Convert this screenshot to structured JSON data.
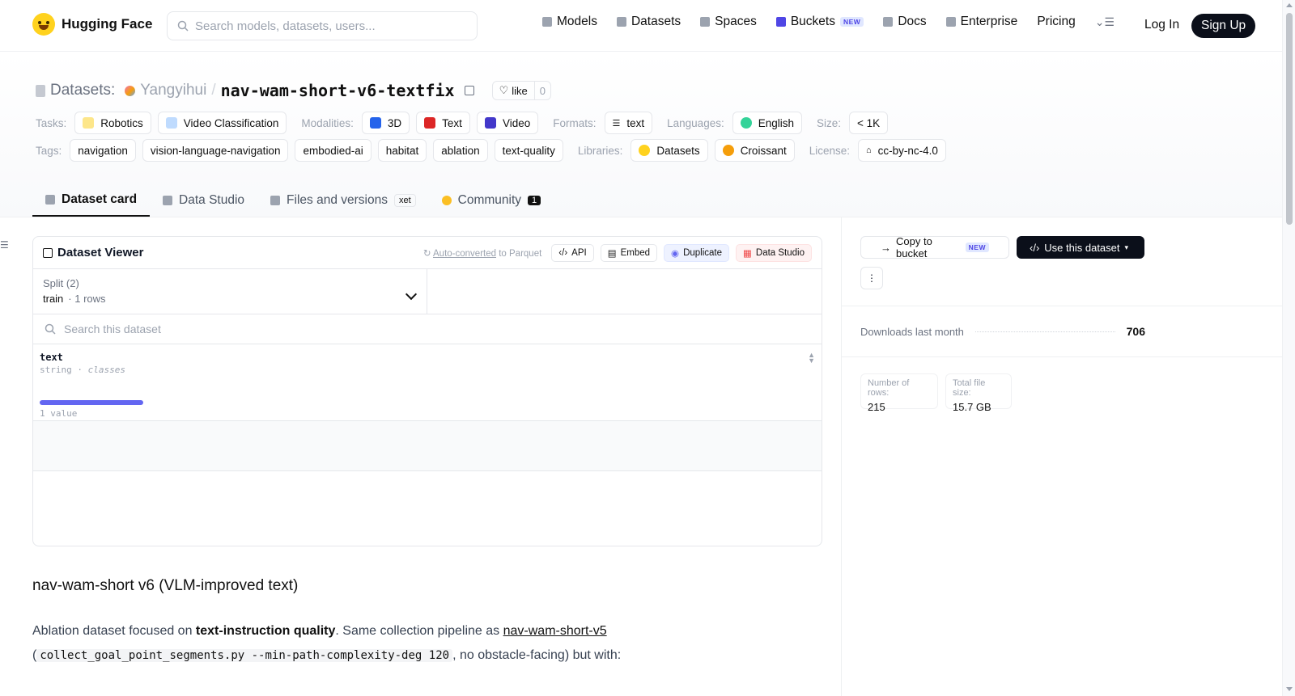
{
  "header": {
    "brand": "Hugging Face",
    "search_placeholder": "Search models, datasets, users...",
    "nav": [
      {
        "label": "Models",
        "icon": "cube-icon"
      },
      {
        "label": "Datasets",
        "icon": "database-icon"
      },
      {
        "label": "Spaces",
        "icon": "grid-icon"
      },
      {
        "label": "Buckets",
        "icon": "bucket-icon",
        "badge": "NEW"
      },
      {
        "label": "Docs",
        "icon": "book-icon"
      },
      {
        "label": "Enterprise",
        "icon": "enterprise-icon"
      },
      {
        "label": "Pricing"
      }
    ],
    "login": "Log In",
    "signup": "Sign Up"
  },
  "repo": {
    "type_label": "Datasets:",
    "owner": "Yangyihui",
    "separator": "/",
    "name": "nav-wam-short-v6-textfix",
    "like_label": "like",
    "like_count": "0"
  },
  "meta": {
    "tasks_label": "Tasks:",
    "tasks": [
      "Robotics",
      "Video Classification"
    ],
    "modalities_label": "Modalities:",
    "modalities": [
      "3D",
      "Text",
      "Video"
    ],
    "formats_label": "Formats:",
    "formats": [
      "text"
    ],
    "languages_label": "Languages:",
    "languages": [
      "English"
    ],
    "size_label": "Size:",
    "size": "< 1K",
    "tags_label": "Tags:",
    "tags": [
      "navigation",
      "vision-language-navigation",
      "embodied-ai",
      "habitat",
      "ablation",
      "text-quality"
    ],
    "libraries_label": "Libraries:",
    "libraries": [
      "Datasets",
      "Croissant"
    ],
    "license_label": "License:",
    "license": "cc-by-nc-4.0"
  },
  "tabs": [
    {
      "label": "Dataset card"
    },
    {
      "label": "Data Studio"
    },
    {
      "label": "Files and versions",
      "badge": "xet"
    },
    {
      "label": "Community",
      "badge": "1"
    }
  ],
  "viewer": {
    "title": "Dataset Viewer",
    "auto_converted": "Auto-converted",
    "to_parquet": "to Parquet",
    "buttons": [
      "API",
      "Embed",
      "Duplicate",
      "Data Studio"
    ],
    "split_label": "Split (2)",
    "split_value": "train",
    "split_rows": "1 rows",
    "search_placeholder": "Search this dataset",
    "column": {
      "name": "text",
      "type": "string",
      "class": "classes",
      "values_label": "1 value",
      "bar_fraction": 1.0
    }
  },
  "card": {
    "heading": "nav-wam-short v6 (VLM-improved text)",
    "p1_a": "Ablation dataset focused on ",
    "p1_b": "text-instruction quality",
    "p1_c": ". Same collection pipeline as ",
    "p1_link": "nav-wam-short-v5",
    "p1_d": "(",
    "p1_code": "collect_goal_point_segments.py --min-path-complexity-deg 120",
    "p1_e": ", no obstacle-facing) but with:"
  },
  "sidebar": {
    "copy_bucket": "Copy to bucket",
    "copy_badge": "NEW",
    "use_dataset": "Use this dataset",
    "downloads_label": "Downloads last month",
    "downloads_value": "706",
    "rows_label": "Number of rows:",
    "rows_value": "215",
    "size_label": "Total file size:",
    "size_value": "15.7 GB"
  },
  "colors": {
    "accent": "#6366f1",
    "dark": "#0b0f1a",
    "brand": "#ffd21e"
  }
}
